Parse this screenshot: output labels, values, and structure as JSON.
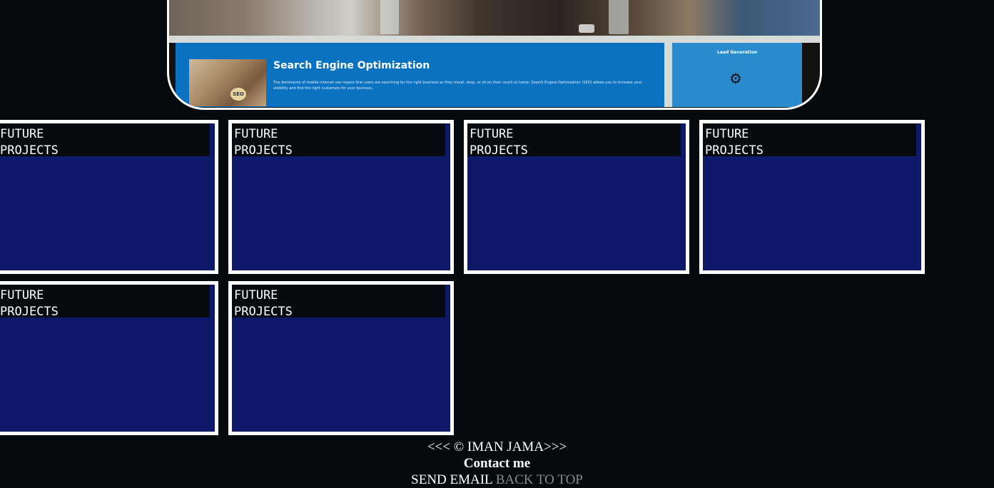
{
  "hero": {
    "seo_title": "Search Engine Optimization",
    "seo_description": "The dominance of mobile internet use means that users are searching for the right business as they travel, shop, or sit on their couch at home. Search Engine Optimization (SEO) allows you to increase your visibility and find the right customers for your business.",
    "seo_badge": "SEO",
    "lead_title": "Lead Generation"
  },
  "projects": [
    {
      "title": "FUTURE\nPROJECTS"
    },
    {
      "title": "FUTURE\nPROJECTS"
    },
    {
      "title": "FUTURE\nPROJECTS"
    },
    {
      "title": "FUTURE\nPROJECTS"
    },
    {
      "title": "FUTURE\nPROJECTS"
    },
    {
      "title": "FUTURE\nPROJECTS"
    }
  ],
  "footer": {
    "copyright": "<<< © IMAN JAMA>>>",
    "contact": "Contact me",
    "send_email": "SEND EMAIL",
    "back_to_top": "BACK TO TOP"
  },
  "colors": {
    "page_bg": "#050a0e",
    "card_fill": "#0f1969",
    "card_border": "#ffffff",
    "seo_blue": "#0a72c1",
    "link_muted": "#8a8a8a"
  }
}
